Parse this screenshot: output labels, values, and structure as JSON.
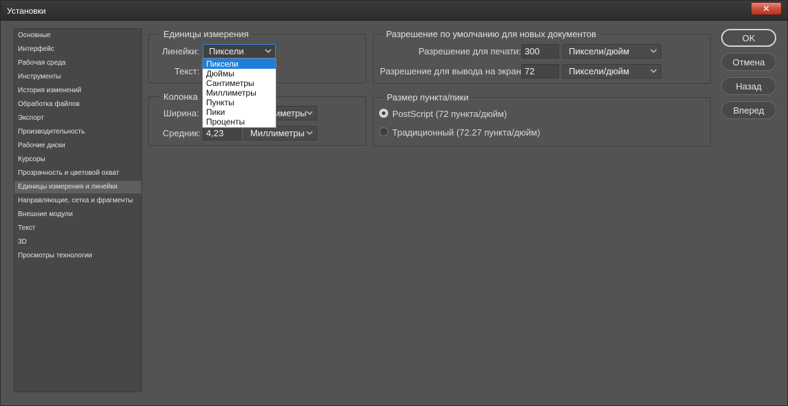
{
  "window": {
    "title": "Установки",
    "close_label": "✕"
  },
  "sidebar": {
    "items": [
      {
        "label": "Основные"
      },
      {
        "label": "Интерфейс"
      },
      {
        "label": "Рабочая среда"
      },
      {
        "label": "Инструменты"
      },
      {
        "label": "История изменений"
      },
      {
        "label": "Обработка файлов"
      },
      {
        "label": "Экспорт"
      },
      {
        "label": "Производительность"
      },
      {
        "label": "Рабочие диски"
      },
      {
        "label": "Курсоры"
      },
      {
        "label": "Прозрачность и цветовой охват"
      },
      {
        "label": "Единицы измерения и линейки",
        "selected": true
      },
      {
        "label": "Направляющие, сетка и фрагменты"
      },
      {
        "label": "Внешние модули"
      },
      {
        "label": "Текст"
      },
      {
        "label": "3D"
      },
      {
        "label": "Просмотры технологии"
      }
    ]
  },
  "units": {
    "title": "Единицы измерения",
    "rulers_label": "Линейки:",
    "rulers_value": "Пиксели",
    "type_label": "Текст:"
  },
  "dropdown": {
    "options": [
      "Пиксели",
      "Дюймы",
      "Сантиметры",
      "Миллиметры",
      "Пункты",
      "Пики",
      "Проценты"
    ],
    "highlighted": "Пиксели"
  },
  "column": {
    "title": "Колонка",
    "width_label": "Ширина:",
    "width_unit": "иметры",
    "gutter_label": "Средник:",
    "gutter_value": "4,23",
    "gutter_unit": "Миллиметры"
  },
  "resolution": {
    "title": "Разрешение по умолчанию для новых документов",
    "print_label": "Разрешение для печати:",
    "print_value": "300",
    "print_unit": "Пиксели/дюйм",
    "screen_label": "Разрешение для вывода на экран:",
    "screen_value": "72",
    "screen_unit": "Пиксели/дюйм"
  },
  "point_size": {
    "title": "Размер пункта/пики",
    "postscript_label": "PostScript (72 пункта/дюйм)",
    "traditional_label": "Традиционный (72.27 пункта/дюйм)",
    "selected": "postscript"
  },
  "buttons": {
    "ok": "OK",
    "cancel": "Отмена",
    "prev": "Назад",
    "next": "Вперед"
  },
  "colors": {
    "dialog_bg": "#535353",
    "sidebar_bg": "#474747",
    "highlight": "#1e7fd8",
    "focus_border": "#2f8ae5",
    "close_button": "#c94a3a"
  }
}
